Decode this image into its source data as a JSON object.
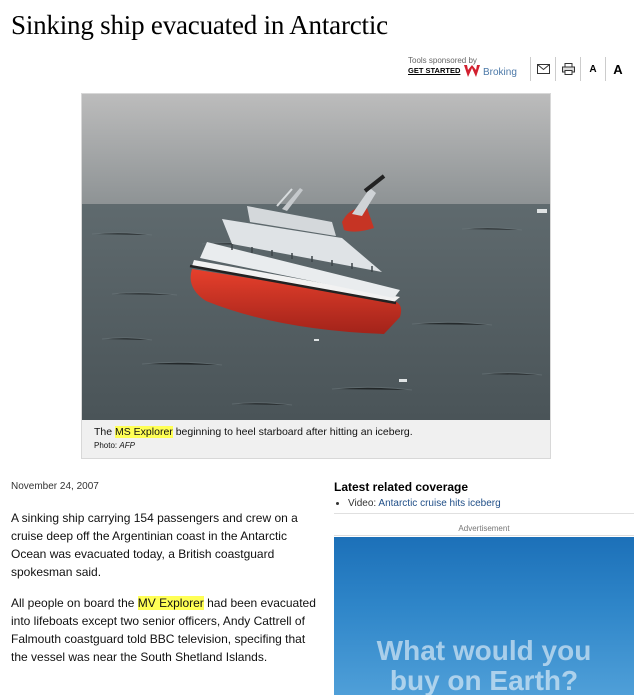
{
  "article": {
    "headline": "Sinking ship evacuated in Antarctic",
    "date": "November 24, 2007",
    "paragraphs": {
      "p1": "A sinking ship carrying 154 passengers and crew on a cruise deep off the Argentinian coast in the Antarctic Ocean was evacuated today, a British coastguard spokesman said.",
      "p2_before": "All people on board the ",
      "p2_highlight": "MV Explorer",
      "p2_after": " had been evacuated into lifeboats except two senior officers, Andy Cattrell of Falmouth coastguard told BBC television, specifing that the vessel was near the South Shetland Islands."
    }
  },
  "tools": {
    "sponsor_label": "Tools sponsored by",
    "sponsor_cta": "GET STARTED",
    "sponsor_brand": "Broking",
    "font_small": "A",
    "font_large": "A",
    "icons": [
      "email-icon",
      "print-icon"
    ]
  },
  "photo": {
    "caption_before": "The ",
    "caption_highlight": "MS Explorer",
    "caption_after": " beginning to heel starboard after hitting an iceberg.",
    "credit_label": "Photo: ",
    "credit_source": "AFP"
  },
  "related": {
    "title": "Latest related coverage",
    "items": [
      {
        "prefix": "Video: ",
        "link": "Antarctic cruise hits iceberg"
      }
    ]
  },
  "ad": {
    "label": "Advertisement",
    "text_line1": "What would you",
    "text_line2": "buy on Earth?"
  },
  "colors": {
    "highlight": "#ffff55",
    "link": "#1f4e87",
    "brand": "#d2202f",
    "ad_blue": "#2f86c9"
  }
}
